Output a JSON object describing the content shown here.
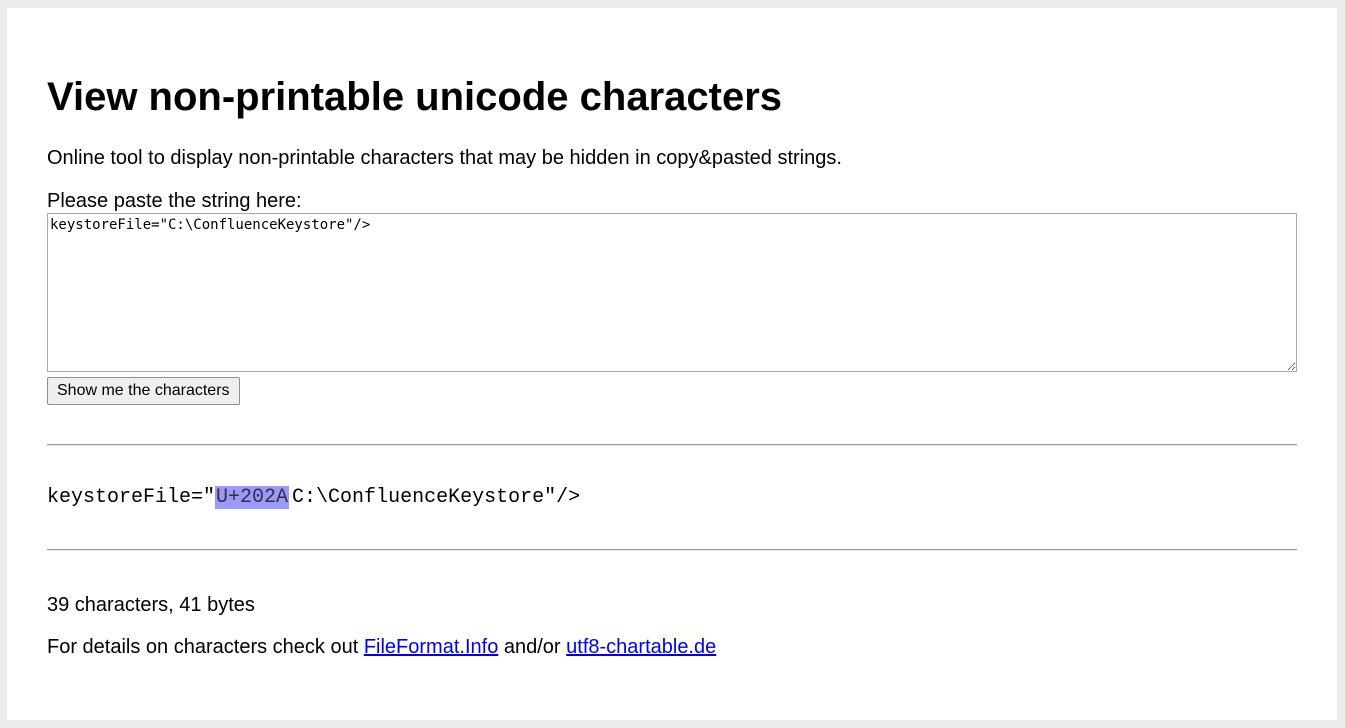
{
  "page": {
    "title": "View non-printable unicode characters",
    "intro": "Online tool to display non-printable characters that may be hidden in copy&pasted strings."
  },
  "form": {
    "prompt_label": "Please paste the string here:",
    "input_value": "keystoreFile=\"C:\\ConfluenceKeystore\"/>",
    "submit_label": "Show me the characters"
  },
  "result": {
    "prefix": "keystoreFile=\"",
    "codepoint": "U+202A",
    "suffix": "C:\\ConfluenceKeystore\"/>",
    "highlight_color": "#9999ff"
  },
  "stats": {
    "text": "39 characters, 41 bytes"
  },
  "details": {
    "prefix": "For details on characters check out ",
    "link1": "FileFormat.Info",
    "middle": " and/or ",
    "link2": "utf8-chartable.de"
  }
}
